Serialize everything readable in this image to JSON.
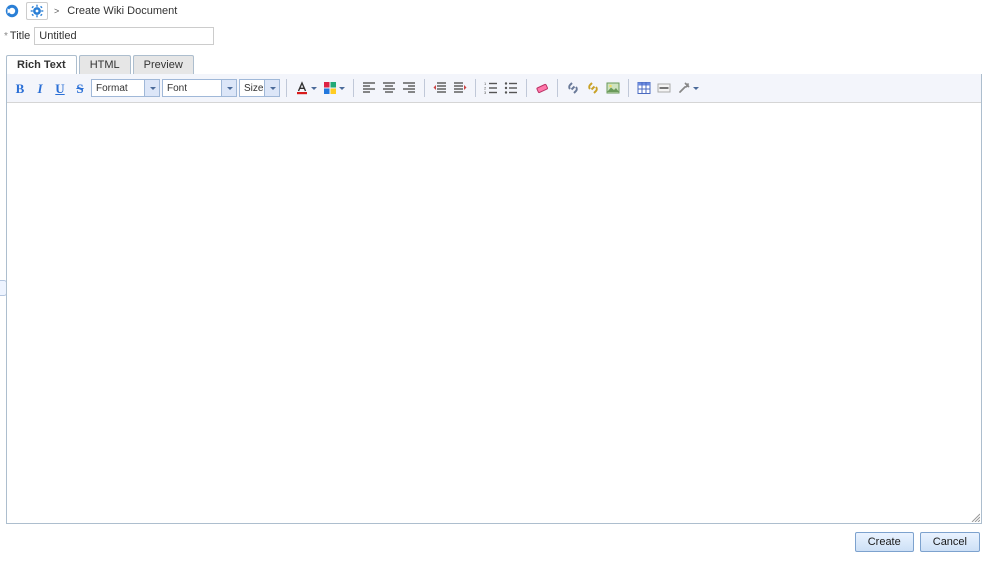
{
  "header": {
    "breadcrumb_text": "Create Wiki Document",
    "breadcrumb_sep": ">"
  },
  "title": {
    "label": "Title",
    "value": "Untitled"
  },
  "tabs": [
    {
      "label": "Rich Text",
      "active": true
    },
    {
      "label": "HTML",
      "active": false
    },
    {
      "label": "Preview",
      "active": false
    }
  ],
  "toolbar": {
    "format": "Format",
    "font": "Font",
    "size": "Size"
  },
  "footer": {
    "create": "Create",
    "cancel": "Cancel"
  }
}
